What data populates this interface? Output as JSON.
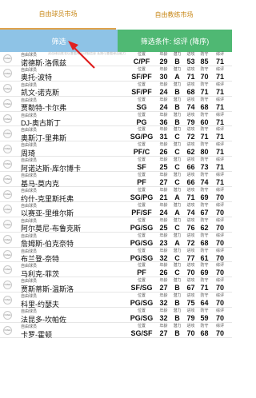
{
  "tabs": [
    {
      "label": "自由球员市场",
      "active": true
    },
    {
      "label": "自由教练市场",
      "active": false
    }
  ],
  "filter": {
    "button_label": "筛选",
    "condition_label": "筛选条件: 综评 (降序)",
    "hint": "双击球员姓名以查看球员详细信息 长按可查看球员能力"
  },
  "stat_labels": {
    "position": "位置",
    "age": "年龄",
    "potential": "潜力",
    "offense": "进攻",
    "defense": "防守",
    "overall": "综评"
  },
  "colors": {
    "tab_text": "#c98a1c",
    "filter_button": "#8ec3e6",
    "filter_condition": "#4fb873",
    "arrow": "#e02020"
  },
  "players": [
    {
      "category": "自由球员",
      "name": "诺德斯·洛佩兹",
      "position": "C/PF",
      "age": "29",
      "potential": "B",
      "offense": "53",
      "defense": "85",
      "overall": "71"
    },
    {
      "category": "自由球员",
      "name": "奥托-波特",
      "position": "SF/PF",
      "age": "30",
      "potential": "A",
      "offense": "71",
      "defense": "70",
      "overall": "71"
    },
    {
      "category": "自由球员",
      "name": "凯文-诺克斯",
      "position": "SF/PF",
      "age": "24",
      "potential": "B",
      "offense": "68",
      "defense": "71",
      "overall": "71"
    },
    {
      "category": "自由球员",
      "name": "贾勒特-卡尔弗",
      "position": "SG",
      "age": "24",
      "potential": "B",
      "offense": "74",
      "defense": "68",
      "overall": "71"
    },
    {
      "category": "自由球员",
      "name": "DJ-奥古斯丁",
      "position": "PG",
      "age": "36",
      "potential": "B",
      "offense": "79",
      "defense": "60",
      "overall": "71"
    },
    {
      "category": "自由球员",
      "name": "奥斯汀-里弗斯",
      "position": "SG/PG",
      "age": "31",
      "potential": "C",
      "offense": "72",
      "defense": "71",
      "overall": "71"
    },
    {
      "category": "自由球员",
      "name": "周琦",
      "position": "PF/C",
      "age": "26",
      "potential": "C",
      "offense": "62",
      "defense": "80",
      "overall": "71"
    },
    {
      "category": "自由球员",
      "name": "阿诺达斯-库尔博卡",
      "position": "SF",
      "age": "25",
      "potential": "C",
      "offense": "66",
      "defense": "73",
      "overall": "71"
    },
    {
      "category": "自由球员",
      "name": "基马-莫内克",
      "position": "PF",
      "age": "27",
      "potential": "C",
      "offense": "66",
      "defense": "74",
      "overall": "71"
    },
    {
      "category": "自由球员",
      "name": "约什-克里斯托弗",
      "position": "SG/PG",
      "age": "21",
      "potential": "A",
      "offense": "71",
      "defense": "69",
      "overall": "70"
    },
    {
      "category": "自由球员",
      "name": "以赛亚-里维尔斯",
      "position": "PF/SF",
      "age": "24",
      "potential": "A",
      "offense": "74",
      "defense": "67",
      "overall": "70"
    },
    {
      "category": "自由球员",
      "name": "阿尔莫尼-布鲁克斯",
      "position": "PG/SG",
      "age": "25",
      "potential": "C",
      "offense": "76",
      "defense": "62",
      "overall": "70"
    },
    {
      "category": "自由球员",
      "name": "詹姆斯-伯克奈特",
      "position": "PG/SG",
      "age": "23",
      "potential": "A",
      "offense": "72",
      "defense": "68",
      "overall": "70"
    },
    {
      "category": "自由球员",
      "name": "布兰登-奈特",
      "position": "PG/SG",
      "age": "32",
      "potential": "C",
      "offense": "77",
      "defense": "61",
      "overall": "70"
    },
    {
      "category": "自由球员",
      "name": "马利克-菲茨",
      "position": "PF",
      "age": "26",
      "potential": "C",
      "offense": "70",
      "defense": "69",
      "overall": "70"
    },
    {
      "category": "自由球员",
      "name": "贾斯蒂斯-温斯洛",
      "position": "SF/SG",
      "age": "27",
      "potential": "B",
      "offense": "67",
      "defense": "71",
      "overall": "70"
    },
    {
      "category": "自由球员",
      "name": "科里-约瑟夫",
      "position": "PG/SG",
      "age": "32",
      "potential": "B",
      "offense": "75",
      "defense": "64",
      "overall": "70"
    },
    {
      "category": "自由球员",
      "name": "法昆多-坎帕佐",
      "position": "PG/SG",
      "age": "32",
      "potential": "B",
      "offense": "79",
      "defense": "59",
      "overall": "70"
    },
    {
      "category": "自由球员",
      "name": "卡罗-霍顿",
      "position": "SG/SF",
      "age": "27",
      "potential": "B",
      "offense": "70",
      "defense": "68",
      "overall": "70"
    }
  ]
}
